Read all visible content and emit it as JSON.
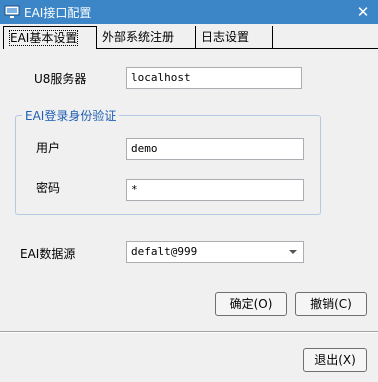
{
  "window": {
    "title": "EAI接口配置",
    "close_glyph": "✕",
    "app_icon": "monitor-icon",
    "title_bar_color": "#3c86c8"
  },
  "tabs": [
    {
      "label": "EAI基本设置",
      "active": true
    },
    {
      "label": "外部系统注册",
      "active": false
    },
    {
      "label": "日志设置",
      "active": false
    }
  ],
  "form": {
    "u8_server": {
      "label": "U8服务器",
      "value": "localhost"
    },
    "auth_group": {
      "title": "EAI登录身份验证"
    },
    "user": {
      "label": "用户",
      "value": "demo"
    },
    "password": {
      "label": "密码",
      "value": "*"
    },
    "datasource": {
      "label": "EAI数据源",
      "value": "defalt@999"
    }
  },
  "buttons": {
    "ok": "确定(O)",
    "cancel": "撤销(C)",
    "exit": "退出(X)"
  },
  "colors": {
    "group_title": "#1c5fb4"
  }
}
